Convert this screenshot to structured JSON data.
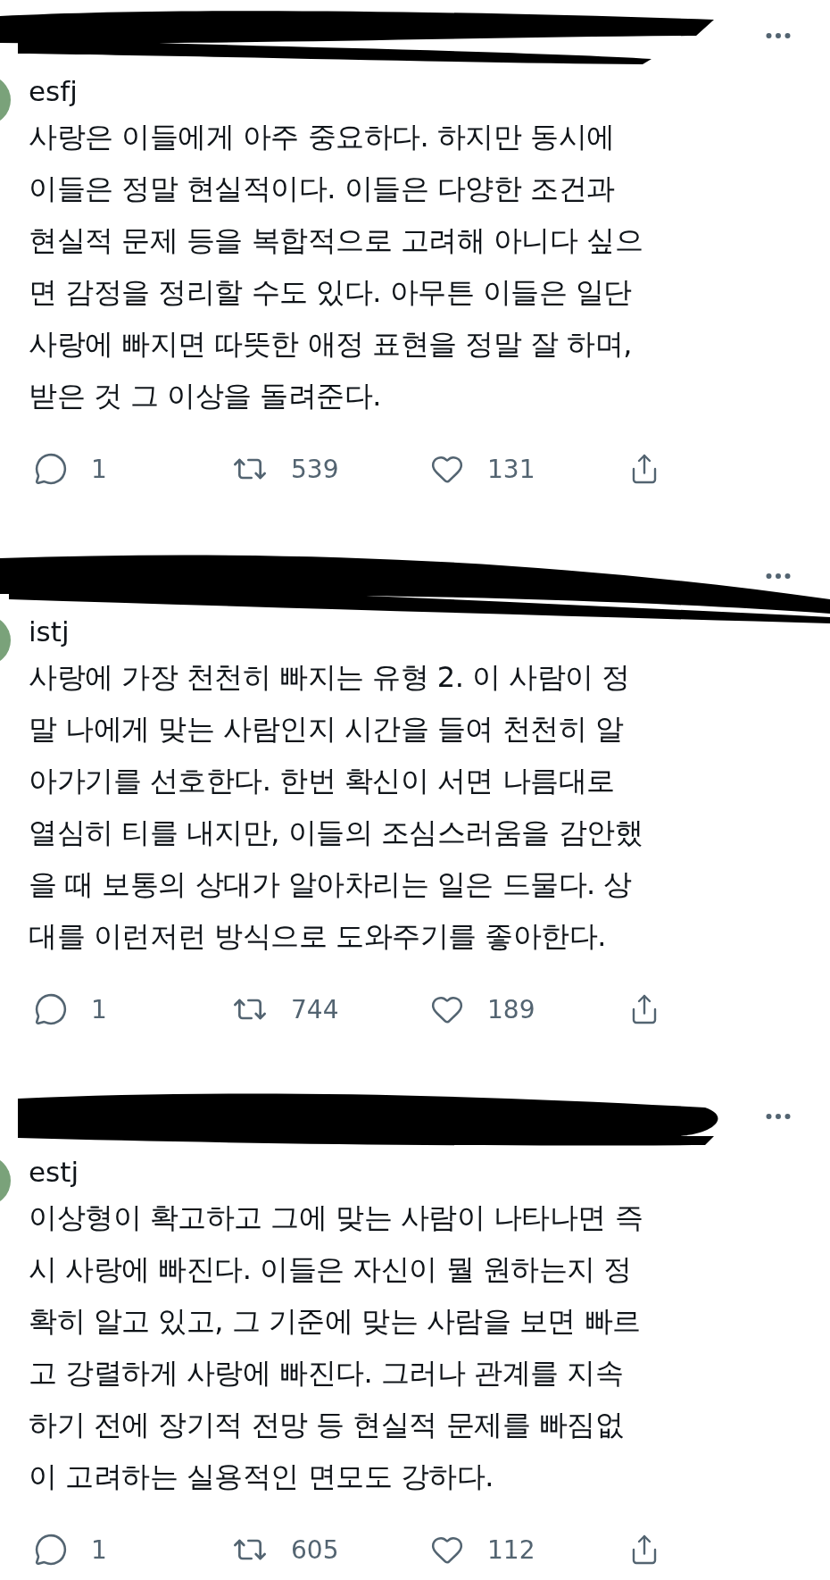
{
  "tweets": [
    {
      "username": "esfj",
      "lines": [
        "사랑은 이들에게 아주 중요하다. 하지만 동시에",
        "이들은 정말 현실적이다. 이들은 다양한 조건과",
        "현실적 문제 등을 복합적으로 고려해 아니다 싶으",
        "면 감정을 정리할 수도 있다. 아무튼 이들은 일단",
        "사랑에 빠지면 따뜻한 애정 표현을 정말 잘 하며,",
        "받은 것 그 이상을 돌려준다."
      ],
      "replies": "1",
      "retweets": "539",
      "likes": "131"
    },
    {
      "username": "istj",
      "lines": [
        "사랑에 가장 천천히 빠지는 유형 2. 이 사람이 정",
        "말 나에게 맞는 사람인지 시간을 들여 천천히 알",
        "아가기를 선호한다. 한번 확신이 서면 나름대로",
        "열심히 티를 내지만, 이들의 조심스러움을 감안했",
        "을 때 보통의 상대가 알아차리는 일은 드물다. 상",
        "대를 이런저런 방식으로 도와주기를 좋아한다."
      ],
      "replies": "1",
      "retweets": "744",
      "likes": "189"
    },
    {
      "username": "estj",
      "lines": [
        "이상형이 확고하고 그에 맞는 사람이 나타나면 즉",
        "시 사랑에 빠진다. 이들은 자신이 뭘 원하는지 정",
        "확히 알고 있고, 그 기준에 맞는 사람을 보면 빠르",
        "고 강렬하게 사랑에 빠진다. 그러나 관계를 지속",
        "하기 전에 장기적 전망 등 현실적 문제를 빠짐없",
        "이 고려하는 실용적인 면모도 강하다."
      ],
      "replies": "1",
      "retweets": "605",
      "likes": "112"
    }
  ]
}
